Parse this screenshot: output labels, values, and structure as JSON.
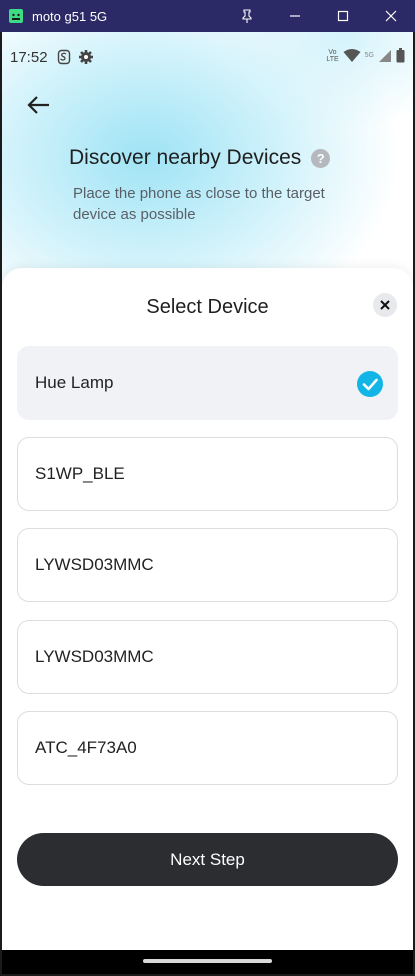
{
  "window": {
    "title": "moto g51 5G",
    "icon": "android-icon",
    "controls": [
      "pin-icon",
      "minimize-icon",
      "maximize-icon",
      "close-icon"
    ]
  },
  "status_bar": {
    "time": "17:52",
    "left_icons": [
      "s-notification-icon",
      "gear-icon"
    ],
    "lte_top": "Vo",
    "lte_mid": "LTE",
    "network_label": "5G",
    "right_icons": [
      "wifi-icon",
      "signal-icon",
      "battery-icon"
    ]
  },
  "page": {
    "title": "Discover nearby Devices",
    "help_glyph": "?",
    "subtitle": "Place the phone as close to the target device as possible"
  },
  "sheet": {
    "title": "Select Device",
    "devices": [
      {
        "name": "Hue Lamp",
        "selected": true
      },
      {
        "name": "S1WP_BLE",
        "selected": false
      },
      {
        "name": "LYWSD03MMC",
        "selected": false
      },
      {
        "name": "LYWSD03MMC",
        "selected": false
      },
      {
        "name": "ATC_4F73A0",
        "selected": false
      }
    ],
    "next_label": "Next Step"
  },
  "colors": {
    "accent": "#13b5e7",
    "button_dark": "#2b2d31",
    "selected_bg": "#f1f2f6",
    "title_bar": "#2b2966"
  }
}
